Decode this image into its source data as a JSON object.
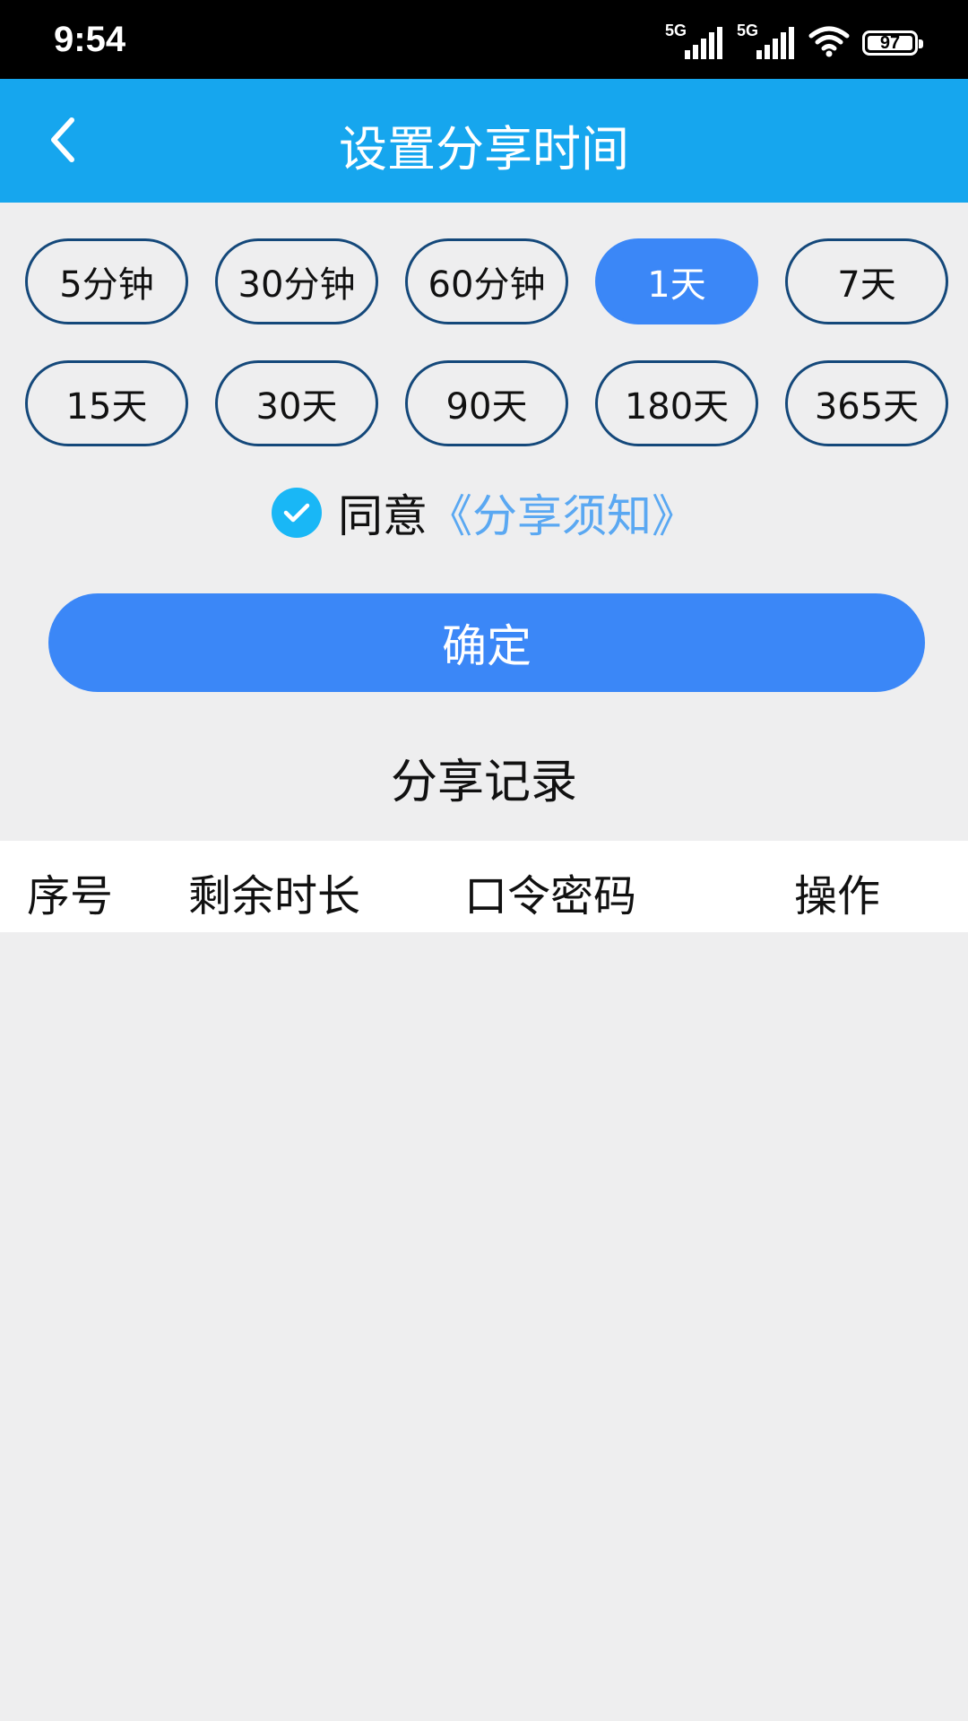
{
  "status_bar": {
    "time": "9:54",
    "signal1_label": "5G",
    "signal2_label": "5G",
    "battery": "97",
    "icons": [
      "signal-icon",
      "signal-icon",
      "wifi-icon",
      "battery-icon"
    ]
  },
  "header": {
    "title": "设置分享时间",
    "back_icon": "chevron-left-icon"
  },
  "durations": {
    "options": [
      "5分钟",
      "30分钟",
      "60分钟",
      "1天",
      "7天",
      "15天",
      "30天",
      "90天",
      "180天",
      "365天"
    ],
    "selected": "1天"
  },
  "agreement": {
    "checked": true,
    "text": "同意",
    "link": "《分享须知》"
  },
  "confirm_label": "确定",
  "records": {
    "title": "分享记录",
    "columns": [
      "序号",
      "剩余时长",
      "口令密码",
      "操作"
    ]
  },
  "colors": {
    "header": "#16a6ee",
    "accent": "#3b87f7",
    "chip_border": "#14487a",
    "link": "#5aa8f2",
    "check": "#19b7f6"
  }
}
